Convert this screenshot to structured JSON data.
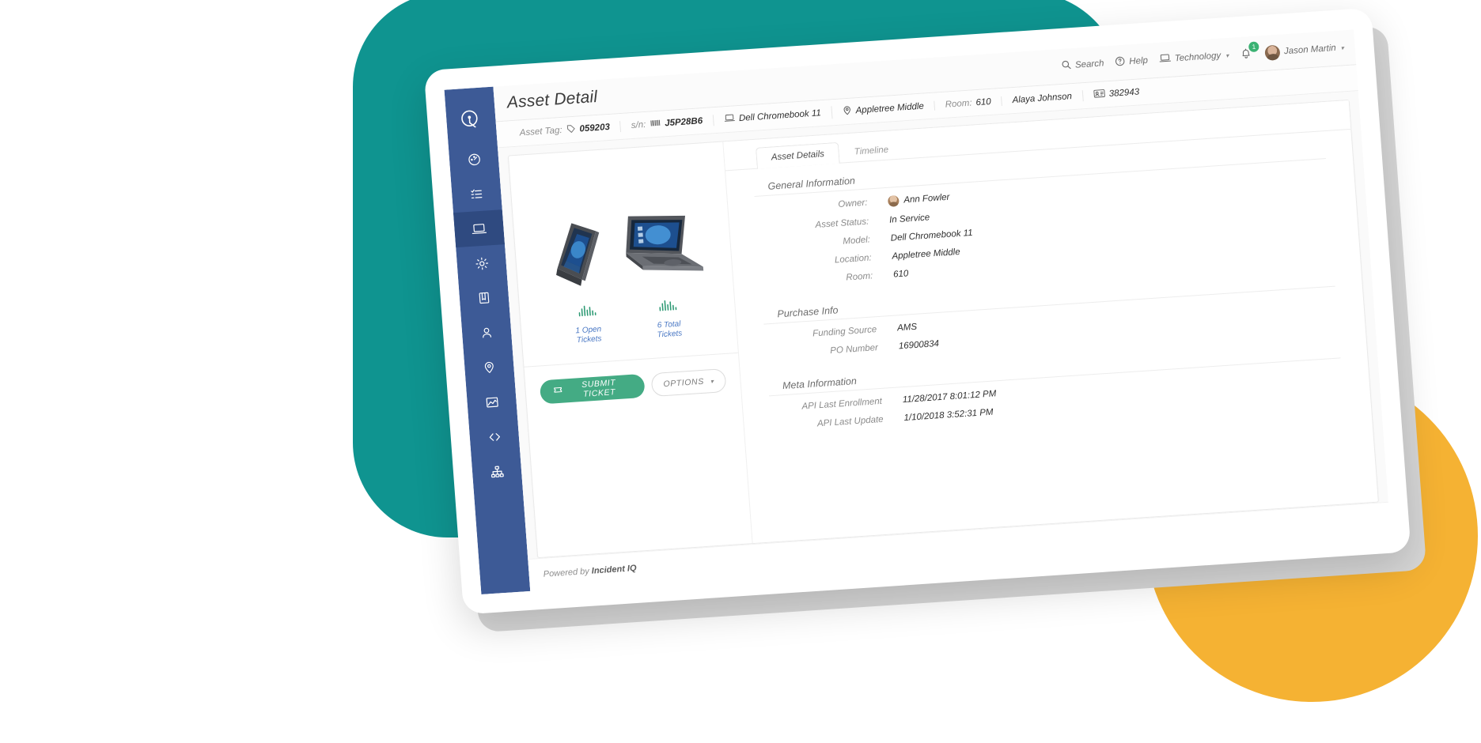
{
  "app": {
    "page_title": "Asset Detail",
    "footer_prefix": "Powered by ",
    "footer_brand": "Incident IQ",
    "logo_icon": "incident-iq-logo-icon"
  },
  "colors": {
    "teal_shape": "#0f9490",
    "yellow_shape": "#f5b233",
    "sidebar_blue": "#3d5a96",
    "sidebar_active_blue": "#2f4a80",
    "primary_green": "#44ab84",
    "badge_green": "#3bb273",
    "link_blue": "#4a78c4"
  },
  "topnav": {
    "search_label": "Search",
    "search_icon": "search-icon",
    "help_label": "Help",
    "help_icon": "question-circle-icon",
    "scope_label": "Technology",
    "scope_icon": "laptop-icon",
    "scope_caret": "▾",
    "notifications_icon": "bell-icon",
    "notifications_count": "1",
    "user_name": "Jason Martin",
    "user_caret": "▾",
    "user_avatar": "avatar"
  },
  "breadcrumb": [
    {
      "label": "Asset Tag:",
      "value": "059203",
      "icon": "tag-icon",
      "bold": true
    },
    {
      "label": "s/n:",
      "value": "J5P28B6",
      "icon": "barcode-icon",
      "bold": true
    },
    {
      "label": "",
      "value": "Dell Chromebook 11",
      "icon": "laptop-icon",
      "bold": false
    },
    {
      "label": "",
      "value": "Appletree Middle",
      "icon": "map-pin-icon",
      "bold": false
    },
    {
      "label": "Room:",
      "value": "610",
      "icon": "",
      "bold": false
    },
    {
      "label": "",
      "value": "Alaya Johnson",
      "icon": "",
      "bold": false
    },
    {
      "label": "",
      "value": "382943",
      "icon": "id-card-icon",
      "bold": false
    }
  ],
  "sidebar": {
    "items": [
      {
        "name": "dashboard",
        "icon": "gauge-icon",
        "active": false
      },
      {
        "name": "tickets",
        "icon": "task-list-icon",
        "active": false
      },
      {
        "name": "assets",
        "icon": "laptop-icon",
        "active": true
      },
      {
        "name": "settings",
        "icon": "gear-icon",
        "active": false
      },
      {
        "name": "knowledge-base",
        "icon": "book-icon",
        "active": false
      },
      {
        "name": "users",
        "icon": "user-icon",
        "active": false
      },
      {
        "name": "locations",
        "icon": "map-pin-icon",
        "active": false
      },
      {
        "name": "analytics",
        "icon": "chart-area-icon",
        "active": false
      },
      {
        "name": "integrations",
        "icon": "code-brackets-icon",
        "active": false
      },
      {
        "name": "organization",
        "icon": "sitemap-icon",
        "active": false
      }
    ]
  },
  "tabs": [
    {
      "label": "Asset Details",
      "active": true
    },
    {
      "label": "Timeline",
      "active": false
    }
  ],
  "asset": {
    "image_alt": "dell-chromebook-11-product-photo",
    "stats": [
      {
        "icon": "bar-chart-icon",
        "line1": "1 Open",
        "line2": "Tickets"
      },
      {
        "icon": "bar-chart-icon",
        "line1": "6 Total",
        "line2": "Tickets"
      }
    ],
    "submit_button": "SUBMIT TICKET",
    "submit_icon": "ticket-icon",
    "options_button": "OPTIONS",
    "options_caret": "▾"
  },
  "sections": [
    {
      "title": "General Information",
      "fields": [
        {
          "label": "Owner:",
          "value": "Ann Fowler",
          "avatar": true
        },
        {
          "label": "Asset Status:",
          "value": "In Service",
          "avatar": false
        },
        {
          "label": "Model:",
          "value": "Dell Chromebook 11",
          "avatar": false
        },
        {
          "label": "Location:",
          "value": "Appletree Middle",
          "avatar": false
        },
        {
          "label": "Room:",
          "value": "610",
          "avatar": false
        }
      ]
    },
    {
      "title": "Purchase Info",
      "fields": [
        {
          "label": "Funding Source",
          "value": "AMS",
          "avatar": false
        },
        {
          "label": "PO Number",
          "value": "16900834",
          "avatar": false
        }
      ]
    },
    {
      "title": "Meta Information",
      "fields": [
        {
          "label": "API Last Enrollment",
          "value": "11/28/2017 8:01:12 PM",
          "avatar": false
        },
        {
          "label": "API Last Update",
          "value": "1/10/2018 3:52:31 PM",
          "avatar": false
        }
      ]
    }
  ]
}
